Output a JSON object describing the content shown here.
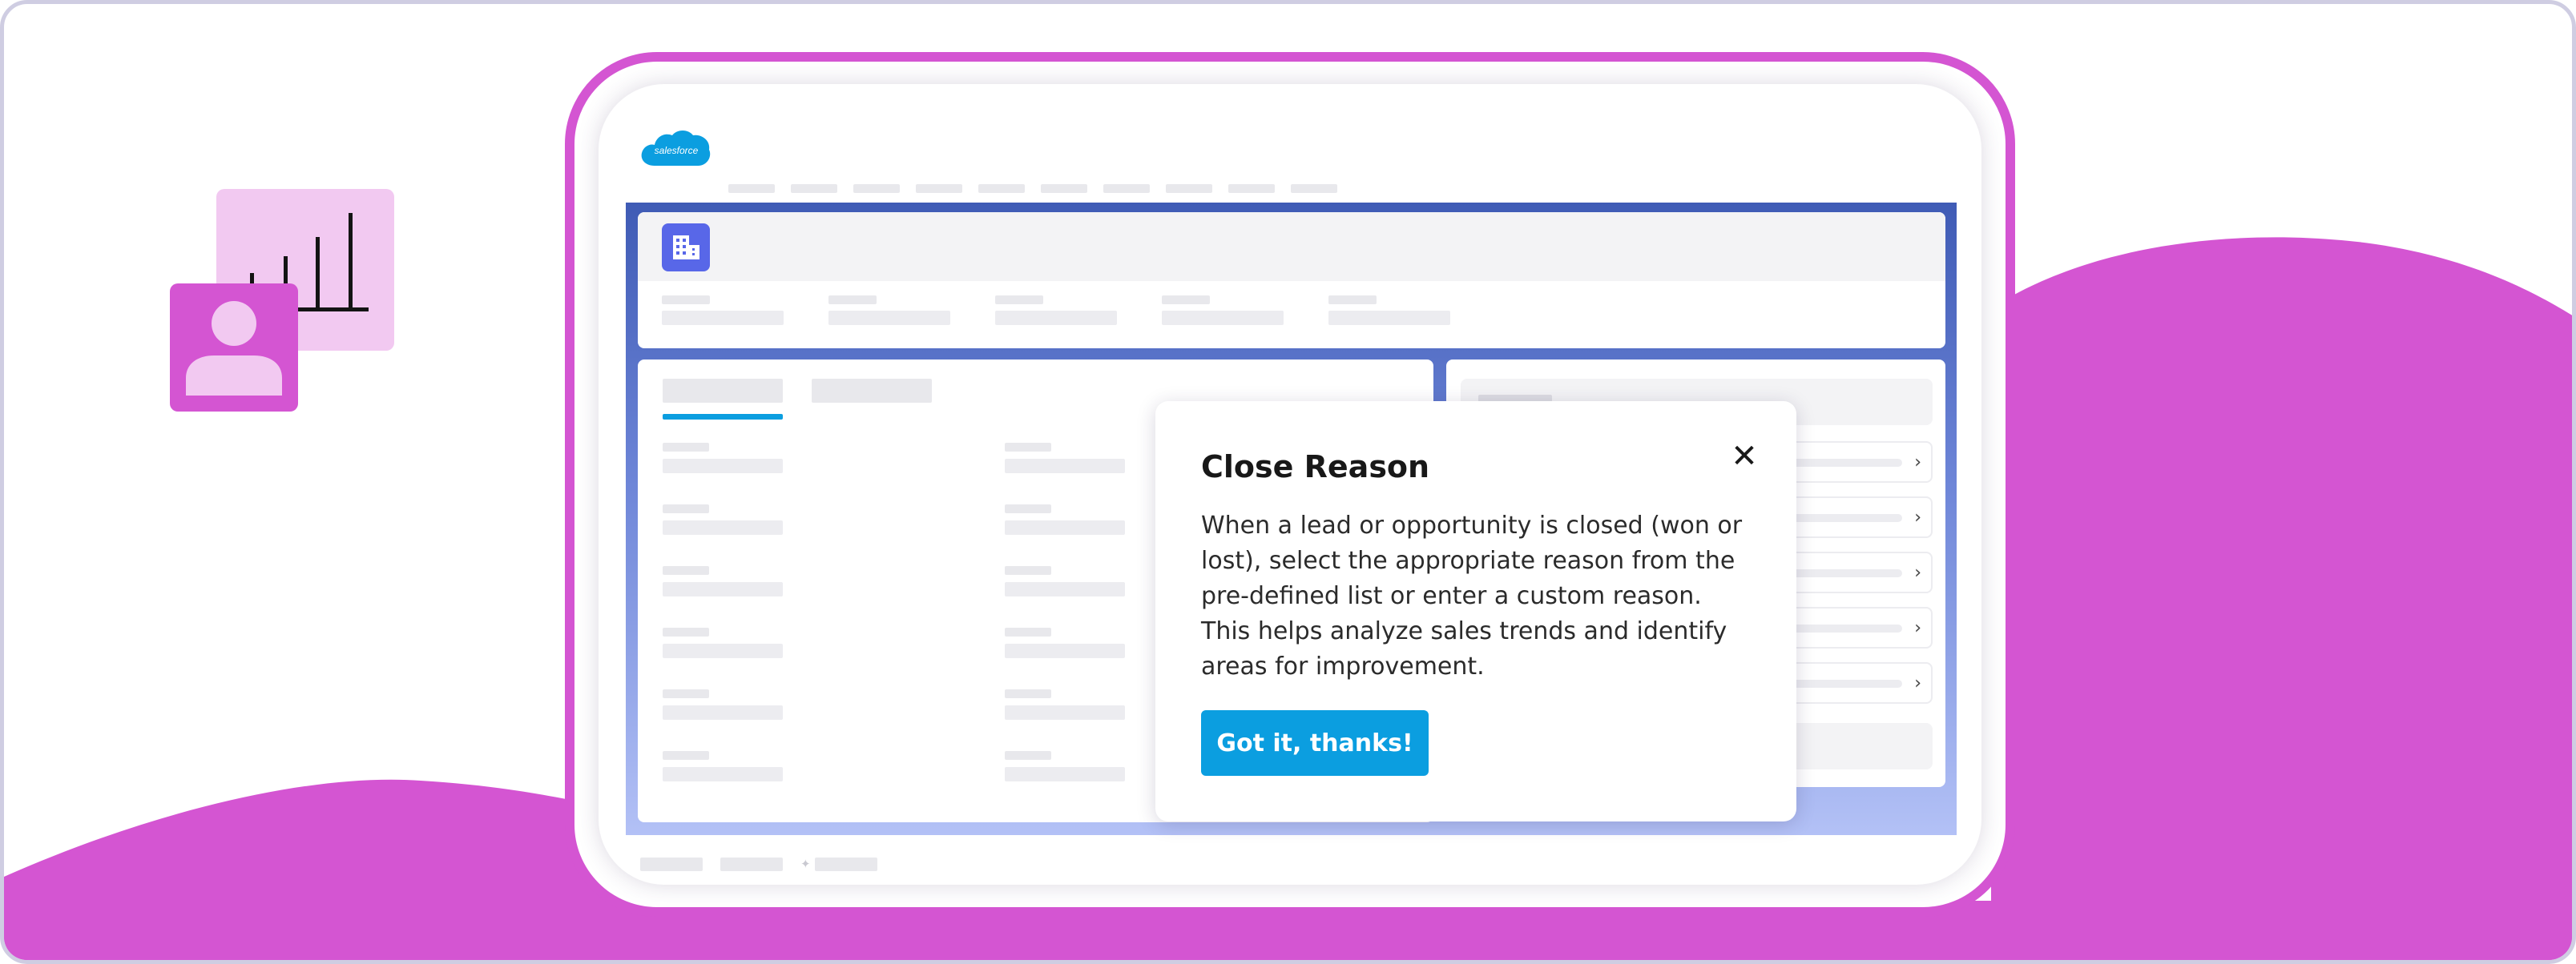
{
  "colors": {
    "magenta": "#d455d2",
    "lightPink": "#f2c9f1",
    "brandBlue": "#0b9ee0",
    "appGradientTop": "#3f5bb5",
    "appGradientBottom": "#b3c1f6",
    "objectIcon": "#5867e8"
  },
  "brand": {
    "logo_text": "salesforce",
    "logo_icon": "salesforce-cloud-logo"
  },
  "record": {
    "icon": "building-icon"
  },
  "popover": {
    "title": "Close Reason",
    "body": "When a lead or opportunity is closed (won or lost),  select the appropriate reason from the pre-defined list or enter a custom reason. This helps analyze sales trends and identify areas for improvement.",
    "button_label": "Got it, thanks!",
    "close_icon": "close-icon",
    "close_glyph": "✕"
  },
  "related_list": {
    "chevron_glyph": "›",
    "item_count": 5
  },
  "illustration": {
    "chart_icon": "bar-chart-icon",
    "user_icon": "user-avatar-icon"
  }
}
